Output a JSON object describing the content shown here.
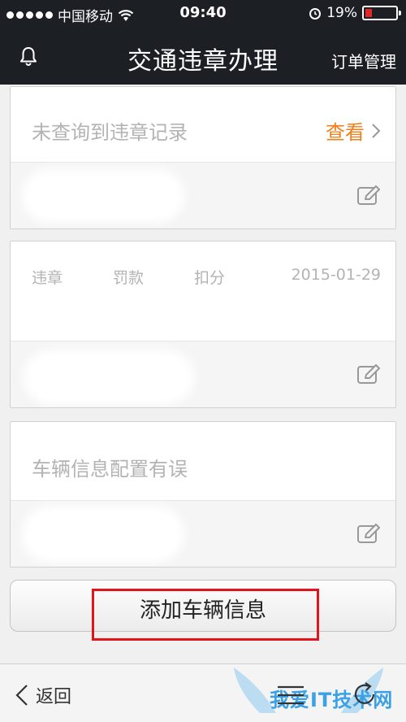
{
  "status": {
    "carrier": "中国移动",
    "time": "09:40",
    "battery": "19%"
  },
  "nav": {
    "title": "交通违章办理",
    "right": "订单管理"
  },
  "cards": [
    {
      "message": "未查询到违章记录",
      "action": "查看"
    },
    {
      "labels": [
        "违章",
        "罚款",
        "扣分"
      ],
      "date": "2015-01-29"
    },
    {
      "message": "车辆信息配置有误"
    }
  ],
  "add_button": "添加车辆信息",
  "toolbar": {
    "back_label": "返回",
    "watermark": "我爱IT技术网"
  },
  "colors": {
    "header": "#1c1f24",
    "accent_orange": "#f07e1a",
    "highlight_red": "#e4141b",
    "battery_low": "#e12828"
  }
}
